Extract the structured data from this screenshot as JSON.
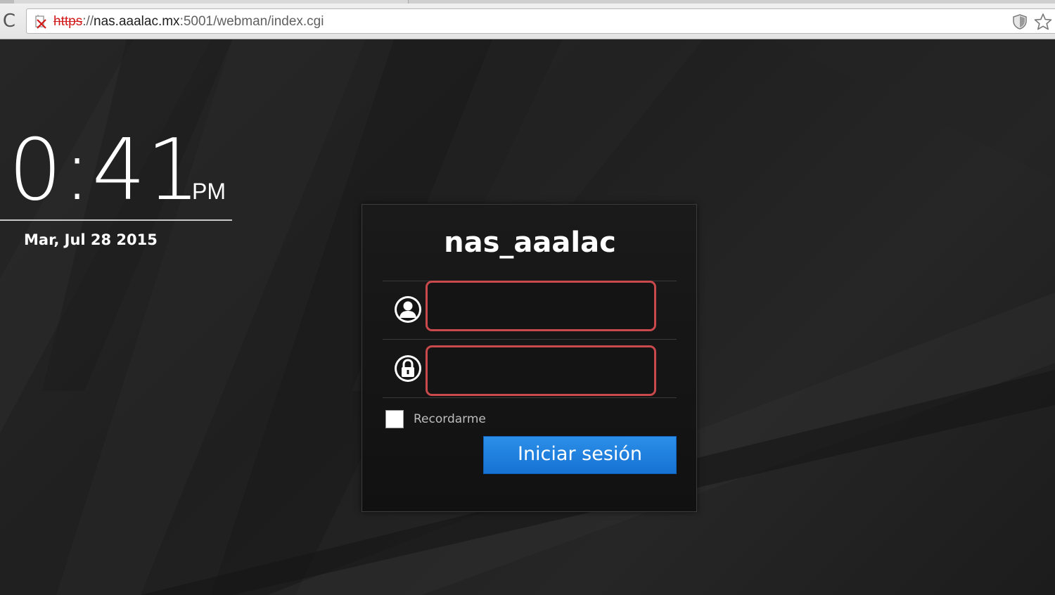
{
  "browser": {
    "url_protocol": "https",
    "url_separator": "://",
    "url_host": "nas.aaalac.mx",
    "url_rest": ":5001/webman/index.cgi",
    "reload_glyph": "C"
  },
  "clock": {
    "time": "0:41",
    "ampm": "PM",
    "date": "Mar, Jul 28 2015"
  },
  "login": {
    "server_name": "nas_aaalac",
    "username_value": "",
    "password_value": "",
    "remember_label": "Recordarme",
    "remember_checked": false,
    "submit_label": "Iniciar sesión"
  },
  "icons": [
    "broken-lock-icon",
    "shield-icon",
    "star-icon",
    "user-icon",
    "lock-icon",
    "reload-icon"
  ],
  "colors": {
    "field_border": "#c9494c",
    "button": "#1f7fe0",
    "background": "#1e1e1e"
  }
}
